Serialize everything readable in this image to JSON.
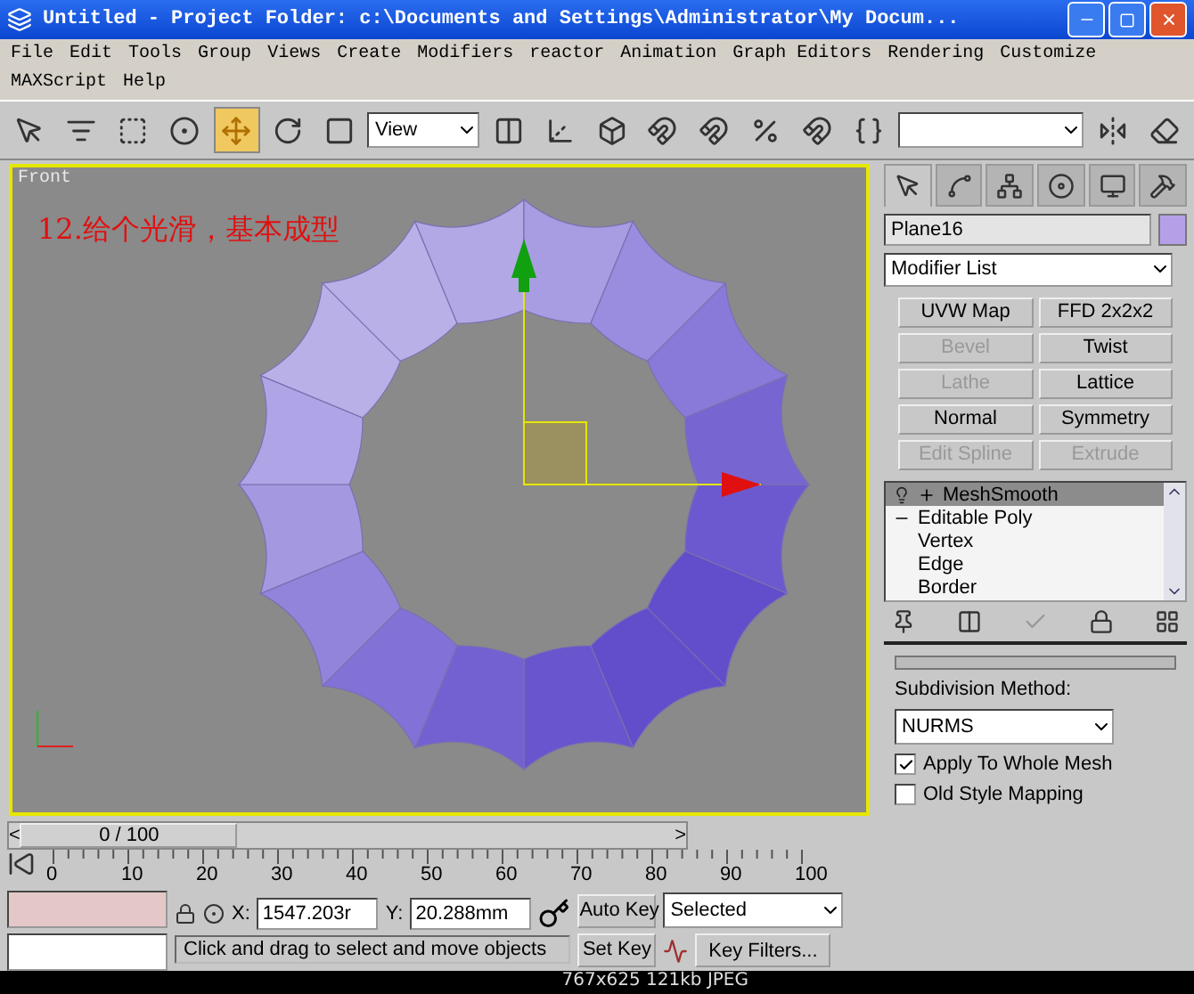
{
  "window": {
    "title": "Untitled",
    "subtitle": "- Project Folder: c:\\Documents and Settings\\Administrator\\My Docum..."
  },
  "menu": [
    "File",
    "Edit",
    "Tools",
    "Group",
    "Views",
    "Create",
    "Modifiers",
    "reactor",
    "Animation",
    "Graph Editors",
    "Rendering",
    "Customize",
    "MAXScript",
    "Help"
  ],
  "toolbar": [
    {
      "kind": "tool",
      "selected": false
    },
    {
      "kind": "tool",
      "selected": false
    },
    {
      "kind": "tool",
      "selected": false
    },
    {
      "kind": "tool",
      "selected": false
    },
    {
      "kind": "tool",
      "selected": true
    },
    {
      "kind": "tool",
      "selected": false
    },
    {
      "kind": "tool",
      "selected": false
    },
    {
      "kind": "dropdown",
      "value": "View"
    },
    {
      "kind": "tool",
      "selected": false
    },
    {
      "kind": "tool",
      "selected": false
    },
    {
      "kind": "tool",
      "selected": false
    },
    {
      "kind": "tool",
      "selected": false
    },
    {
      "kind": "tool",
      "selected": false
    },
    {
      "kind": "tool",
      "selected": false
    },
    {
      "kind": "tool",
      "selected": false
    },
    {
      "kind": "tool",
      "selected": false
    },
    {
      "kind": "dropdown"
    },
    {
      "kind": "tool",
      "selected": false
    },
    {
      "kind": "tool",
      "selected": false
    }
  ],
  "viewport": {
    "label": "Front",
    "caption": "12.给个光滑，基本成型"
  },
  "panel": {
    "tabs": [
      {
        "selected": true
      },
      {
        "selected": false
      },
      {
        "selected": false
      },
      {
        "selected": false
      },
      {
        "selected": false
      },
      {
        "selected": false
      }
    ],
    "object_name": "Plane16",
    "modifier_list": "Modifier List",
    "buttons": [
      {
        "label": "UVW Map",
        "disabled": false
      },
      {
        "label": "FFD 2x2x2",
        "disabled": false
      },
      {
        "label": "Bevel",
        "disabled": true
      },
      {
        "label": "Twist",
        "disabled": false
      },
      {
        "label": "Lathe",
        "disabled": true
      },
      {
        "label": "Lattice",
        "disabled": false
      },
      {
        "label": "Normal",
        "disabled": false
      },
      {
        "label": "Symmetry",
        "disabled": false
      },
      {
        "label": "Edit Spline",
        "disabled": true
      },
      {
        "label": "Extrude",
        "disabled": true
      }
    ],
    "stack": [
      {
        "label": "MeshSmooth",
        "selected": true,
        "expanded": false
      },
      {
        "label": "Editable Poly",
        "selected": false,
        "expanded": true,
        "children": [
          {
            "label": "Vertex",
            "selected": false
          },
          {
            "label": "Edge",
            "selected": false
          },
          {
            "label": "Border",
            "selected": false
          }
        ]
      }
    ],
    "rollout": {
      "label": "Subdivision Method:",
      "method": "NURMS",
      "options": [
        {
          "label": "Apply To Whole Mesh",
          "checked": true
        },
        {
          "label": "Old Style Mapping",
          "checked": false
        }
      ]
    }
  },
  "timeline": {
    "position": "0 / 100",
    "level": 0,
    "prev": "<",
    "next": ">",
    "ruler_labels": [
      "0",
      "10",
      "20",
      "30",
      "40",
      "50",
      "60",
      "70",
      "80",
      "90",
      "100"
    ]
  },
  "status": {
    "x_label": "X:",
    "x": "1547.203r",
    "y_label": "Y:",
    "y": "20.288mm",
    "prompt": "Click and drag to select and move objects",
    "auto_key": "Auto Key",
    "set_key": "Set Key",
    "key_mode": "Selected",
    "key_filters": "Key Filters..."
  },
  "caption": "767x625 121kb JPEG"
}
